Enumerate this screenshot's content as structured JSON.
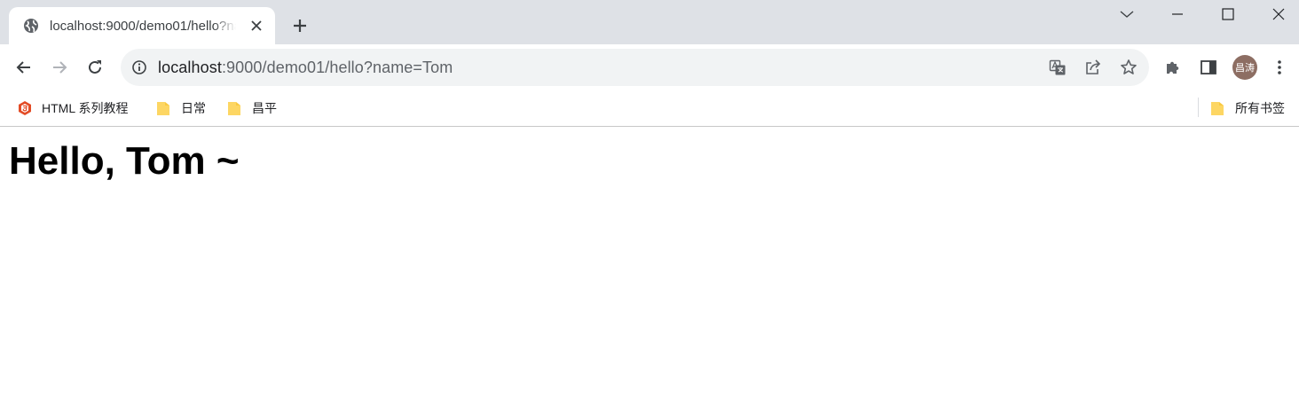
{
  "browser": {
    "tab": {
      "title": "localhost:9000/demo01/hello?name=Tom",
      "favicon": "globe-icon"
    },
    "address_bar": {
      "host": "localhost",
      "path": ":9000/demo01/hello?name=Tom"
    },
    "profile": {
      "avatar_text": "昌涛",
      "avatar_color": "#8d6e63"
    },
    "bookmarks": [
      {
        "label": "HTML 系列教程",
        "icon": "html5-logo-icon"
      },
      {
        "label": "日常",
        "icon": "folder-icon"
      },
      {
        "label": "昌平",
        "icon": "folder-icon"
      }
    ],
    "all_bookmarks": {
      "label": "所有书签",
      "icon": "folder-icon"
    },
    "colors": {
      "tabstrip": "#dee1e6",
      "omnibox": "#f1f3f4",
      "folder": "#fdd663"
    }
  },
  "page": {
    "heading": "Hello, Tom ~"
  }
}
